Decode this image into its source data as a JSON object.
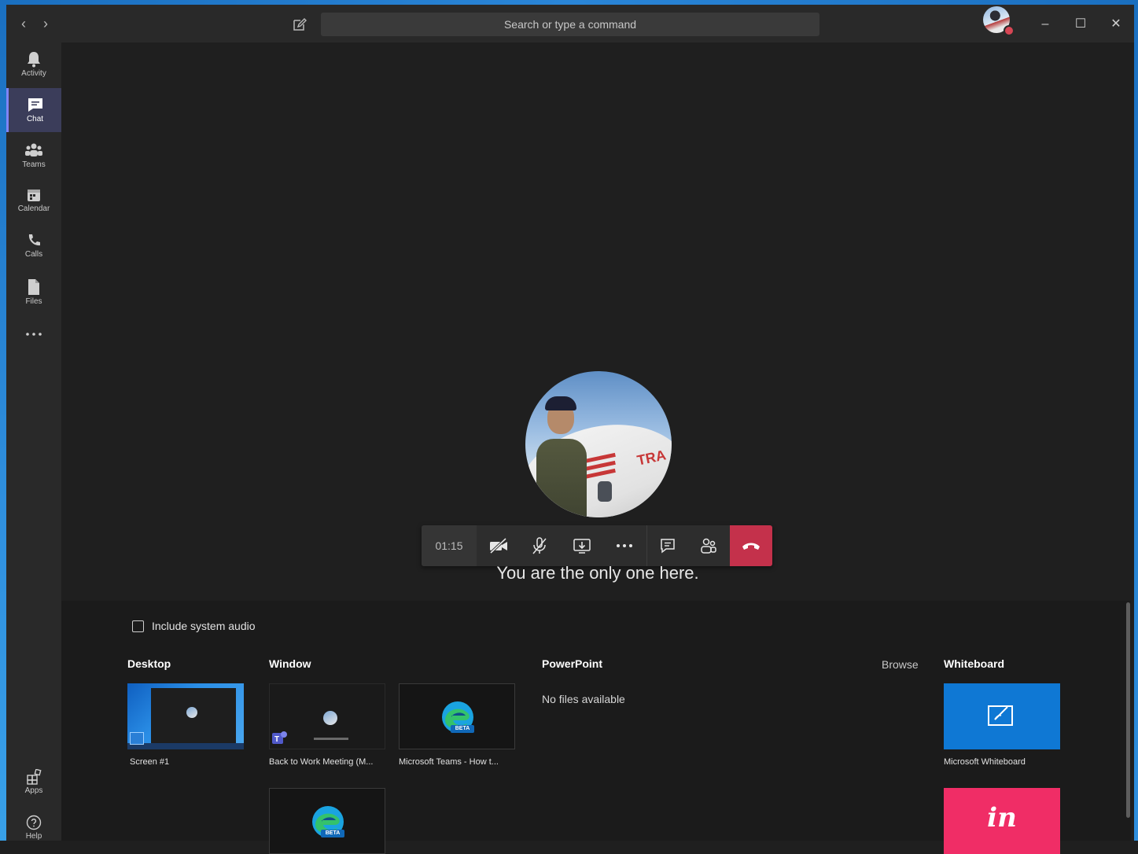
{
  "titlebar": {
    "search_placeholder": "Search or type a command"
  },
  "rail": {
    "items": [
      {
        "label": "Activity",
        "icon": "bell-icon"
      },
      {
        "label": "Chat",
        "icon": "chat-icon"
      },
      {
        "label": "Teams",
        "icon": "teams-icon"
      },
      {
        "label": "Calendar",
        "icon": "calendar-icon"
      },
      {
        "label": "Calls",
        "icon": "phone-icon"
      },
      {
        "label": "Files",
        "icon": "file-icon"
      }
    ],
    "bottom": [
      {
        "label": "Apps",
        "icon": "apps-icon"
      },
      {
        "label": "Help",
        "icon": "help-icon"
      }
    ]
  },
  "call": {
    "timer": "01:15",
    "message": "You are the only one here.",
    "plane_text": "TRA",
    "hangup_color": "#c4314b"
  },
  "share": {
    "include_audio_label": "Include system audio",
    "desktop_title": "Desktop",
    "window_title": "Window",
    "powerpoint_title": "PowerPoint",
    "browse_label": "Browse",
    "whiteboard_title": "Whiteboard",
    "no_files": "No files available",
    "desktop_items": [
      {
        "caption": "Screen #1"
      }
    ],
    "window_items": [
      {
        "caption": "Back to Work Meeting (M..."
      },
      {
        "caption": "Microsoft Teams - How t..."
      }
    ],
    "beta_badge": "BETA",
    "whiteboard_items": [
      {
        "caption": "Microsoft Whiteboard"
      },
      {
        "logo_text": "in"
      }
    ]
  }
}
